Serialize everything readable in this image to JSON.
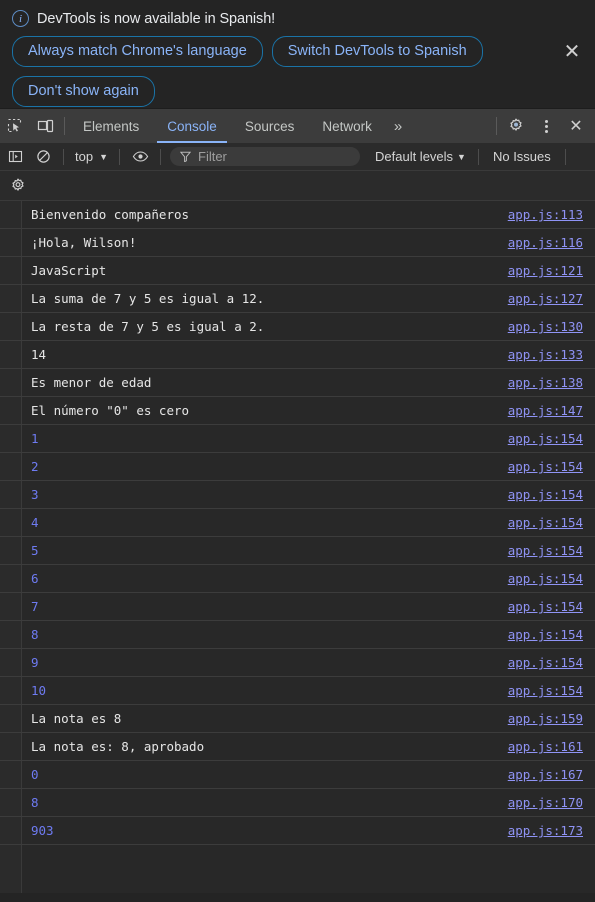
{
  "banner": {
    "icon": "info-circle-icon",
    "message": "DevTools is now available in Spanish!",
    "buttons": [
      "Always match Chrome's language",
      "Switch DevTools to Spanish",
      "Don't show again"
    ],
    "close_label": "✕"
  },
  "tabbar": {
    "inspect_icon": "inspect-element-icon",
    "device_icon": "device-toolbar-icon",
    "tabs": [
      {
        "label": "Elements",
        "active": false
      },
      {
        "label": "Console",
        "active": true
      },
      {
        "label": "Sources",
        "active": false
      },
      {
        "label": "Network",
        "active": false
      }
    ],
    "more_label": "»",
    "settings_icon": "gear-icon",
    "menu_icon": "kebab-menu-icon",
    "close_label": "✕"
  },
  "filterbar": {
    "sidebar_icon": "console-sidebar-icon",
    "clear_icon": "clear-console-icon",
    "context": "top",
    "caret": "▼",
    "eye_icon": "live-expression-eye-icon",
    "filter_icon": "filter-funnel-icon",
    "filter_value": "",
    "filter_placeholder": "Filter",
    "levels_label": "Default levels",
    "levels_caret": "▼",
    "issues_label": "No Issues"
  },
  "gearrow": {
    "settings_icon": "console-settings-gear-icon"
  },
  "console": {
    "prompt": "❯",
    "rows": [
      {
        "message": "Bienvenido compañeros",
        "type": "text",
        "source": "app.js:113"
      },
      {
        "message": "¡Hola, Wilson!",
        "type": "text",
        "source": "app.js:116"
      },
      {
        "message": "JavaScript",
        "type": "text",
        "source": "app.js:121"
      },
      {
        "message": "La suma de 7 y 5 es igual a 12.",
        "type": "text",
        "source": "app.js:127"
      },
      {
        "message": "La resta de 7 y 5 es igual a 2.",
        "type": "text",
        "source": "app.js:130"
      },
      {
        "message": "14",
        "type": "text",
        "source": "app.js:133"
      },
      {
        "message": "Es menor de edad",
        "type": "text",
        "source": "app.js:138"
      },
      {
        "message": "El número \"0\" es cero",
        "type": "text",
        "source": "app.js:147"
      },
      {
        "message": "1",
        "type": "number",
        "source": "app.js:154"
      },
      {
        "message": "2",
        "type": "number",
        "source": "app.js:154"
      },
      {
        "message": "3",
        "type": "number",
        "source": "app.js:154"
      },
      {
        "message": "4",
        "type": "number",
        "source": "app.js:154"
      },
      {
        "message": "5",
        "type": "number",
        "source": "app.js:154"
      },
      {
        "message": "6",
        "type": "number",
        "source": "app.js:154"
      },
      {
        "message": "7",
        "type": "number",
        "source": "app.js:154"
      },
      {
        "message": "8",
        "type": "number",
        "source": "app.js:154"
      },
      {
        "message": "9",
        "type": "number",
        "source": "app.js:154"
      },
      {
        "message": "10",
        "type": "number",
        "source": "app.js:154"
      },
      {
        "message": "La nota es 8",
        "type": "text",
        "source": "app.js:159"
      },
      {
        "message": "La nota es: 8, aprobado",
        "type": "text",
        "source": "app.js:161"
      },
      {
        "message": "0",
        "type": "number",
        "source": "app.js:167"
      },
      {
        "message": "8",
        "type": "number",
        "source": "app.js:170"
      },
      {
        "message": "903",
        "type": "number",
        "source": "app.js:173"
      }
    ]
  },
  "colors": {
    "background": "#242424",
    "console_bg": "#282828",
    "toolbar_bg": "#3c3c3c",
    "accent_blue": "#8ab4f8",
    "link": "#8f93f5",
    "number": "#6e7bf2",
    "text": "#e6e6e6"
  }
}
